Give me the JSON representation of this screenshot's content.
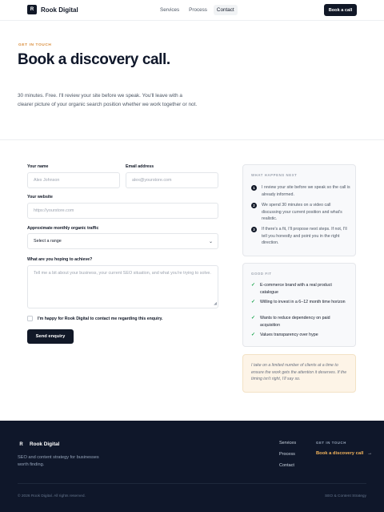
{
  "nav": {
    "brand_mark": "R",
    "brand": "Rook Digital",
    "links": [
      "Services",
      "Process",
      "Contact"
    ],
    "active_link": "Contact",
    "cta": "Book a call"
  },
  "hero": {
    "eyebrow": "GET IN TOUCH",
    "title": "Book a discovery call.",
    "subtitle": "30 minutes. Free. I'll review your site before we speak. You'll leave with a clearer picture of your organic search position whether we work together or not."
  },
  "form": {
    "name": {
      "label": "Your name",
      "placeholder": "Alex Johnson"
    },
    "email": {
      "label": "Email address",
      "placeholder": "alex@yourstore.com"
    },
    "website": {
      "label": "Your website",
      "placeholder": "https://yourstore.com"
    },
    "traffic": {
      "label": "Approximate monthly organic traffic",
      "value": "Select a range"
    },
    "goal": {
      "label": "What are you hoping to achieve?",
      "placeholder": "Tell me a bit about your business, your current SEO situation, and what you're trying to solve."
    },
    "consent": "I'm happy for Rook Digital to contact me regarding this enquiry.",
    "submit": "Send enquiry"
  },
  "next": {
    "heading": "WHAT HAPPENS NEXT",
    "steps": [
      {
        "num": "1",
        "text": "I review your site before we speak so the call is already informed."
      },
      {
        "num": "2",
        "text": "We spend 30 minutes on a video call discussing your current position and what's realistic."
      },
      {
        "num": "3",
        "text": "If there's a fit, I'll propose next steps. If not, I'll tell you honestly and point you in the right direction."
      }
    ]
  },
  "fit": {
    "heading": "GOOD FIT",
    "items": [
      "E-commerce brand with a real product catalogue",
      "Willing to invest in a 6–12 month time horizon",
      "Wants to reduce dependency on paid acquisition",
      "Values transparency over hype"
    ]
  },
  "note": "I take on a limited number of clients at a time to ensure the work gets the attention it deserves. If the timing isn't right, I'll say so.",
  "footer": {
    "brand_mark": "R",
    "brand": "Rook Digital",
    "tagline": "SEO and content strategy for businesses worth finding.",
    "links": [
      "Services",
      "Process",
      "Contact"
    ],
    "cta_heading": "GET IN TOUCH",
    "cta": "Book a discovery call",
    "copyright": "© 2026 Rook Digital. All rights reserved.",
    "right_text": "SEO & Content Strategy"
  },
  "colors": {
    "accent": "#d98c3a",
    "dark": "#111827",
    "footer_bg": "#0f172a",
    "cta_footer": "#f5b55c"
  }
}
